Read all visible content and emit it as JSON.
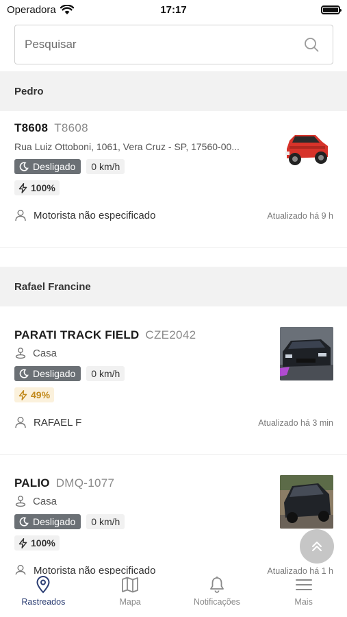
{
  "status_bar": {
    "carrier": "Operadora",
    "time": "17:17"
  },
  "search": {
    "placeholder": "Pesquisar"
  },
  "groups": [
    {
      "name": "Pedro",
      "vehicles": [
        {
          "name": "T8608",
          "plate": "T8608",
          "address": "Rua Luiz Ottoboni, 1061, Vera Cruz - SP, 17560-00...",
          "status": "Desligado",
          "speed": "0 km/h",
          "battery": "100%",
          "driver": "Motorista não especificado",
          "updated": "Atualizado há 9 h",
          "photo": "red-suv"
        }
      ]
    },
    {
      "name": "Rafael Francine",
      "vehicles": [
        {
          "name": "PARATI TRACK FIELD",
          "plate": "CZE2042",
          "location": "Casa",
          "status": "Desligado",
          "speed": "0 km/h",
          "battery": "49%",
          "driver": "RAFAEL F",
          "updated": "Atualizado há 3 min",
          "photo": "dark-car"
        },
        {
          "name": "PALIO",
          "plate": "DMQ-1077",
          "location": "Casa",
          "status": "Desligado",
          "speed": "0 km/h",
          "battery": "100%",
          "driver": "Motorista não especificado",
          "updated": "Atualizado há 1 h",
          "photo": "dark-sedan"
        }
      ]
    }
  ],
  "nav": [
    {
      "label": "Rastreados",
      "icon": "location-pin-icon",
      "active": true
    },
    {
      "label": "Mapa",
      "icon": "map-icon"
    },
    {
      "label": "Notificações",
      "icon": "bell-icon"
    },
    {
      "label": "Mais",
      "icon": "menu-icon"
    }
  ],
  "colors": {
    "accent": "#2c3e73",
    "badge_off": "#6b7075",
    "battery_warning": "#c28a1c"
  }
}
